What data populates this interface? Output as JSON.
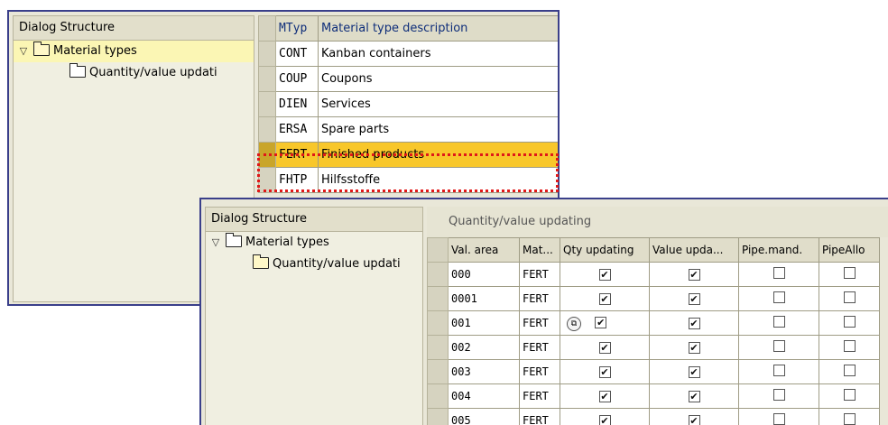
{
  "back": {
    "tree": {
      "title": "Dialog Structure",
      "items": [
        {
          "label": "Material types",
          "expanded": true,
          "selected": true
        },
        {
          "label": "Quantity/value updati"
        }
      ]
    },
    "table": {
      "headers": [
        "MTyp",
        "Material type description"
      ],
      "rows": [
        {
          "code": "CONT",
          "desc": "Kanban containers"
        },
        {
          "code": "COUP",
          "desc": "Coupons"
        },
        {
          "code": "DIEN",
          "desc": "Services"
        },
        {
          "code": "ERSA",
          "desc": "Spare parts"
        },
        {
          "code": "FERT",
          "desc": "Finished products",
          "highlighted": true
        },
        {
          "code": "FHTP",
          "desc": "Hilfsstoffe"
        }
      ]
    }
  },
  "front": {
    "tree": {
      "title": "Dialog Structure",
      "items": [
        {
          "label": "Material types",
          "expanded": true
        },
        {
          "label": "Quantity/value updati",
          "selected": true
        }
      ]
    },
    "grid_title": "Quantity/value updating",
    "headers": [
      "Val. area",
      "Mat...",
      "Qty updating",
      "Value upda...",
      "Pipe.mand.",
      "PipeAllo"
    ],
    "rows": [
      {
        "area": "000",
        "mat": "FERT",
        "qty": true,
        "val": true,
        "pipe": false,
        "alloc": false
      },
      {
        "area": "0001",
        "mat": "FERT",
        "qty": true,
        "val": true,
        "pipe": false,
        "alloc": false
      },
      {
        "area": "001",
        "mat": "FERT",
        "qty": true,
        "val": true,
        "pipe": false,
        "alloc": false,
        "lookup": true
      },
      {
        "area": "002",
        "mat": "FERT",
        "qty": true,
        "val": true,
        "pipe": false,
        "alloc": false
      },
      {
        "area": "003",
        "mat": "FERT",
        "qty": true,
        "val": true,
        "pipe": false,
        "alloc": false
      },
      {
        "area": "004",
        "mat": "FERT",
        "qty": true,
        "val": true,
        "pipe": false,
        "alloc": false
      },
      {
        "area": "005",
        "mat": "FERT",
        "qty": true,
        "val": true,
        "pipe": false,
        "alloc": false
      }
    ]
  },
  "colors": {
    "highlight": "#f8c72b",
    "window_border": "#3a3f8a",
    "callout": "#e01818"
  },
  "icons": {
    "expand": "triangle-down-icon",
    "folder": "folder-icon",
    "lookup": "value-help-icon"
  }
}
